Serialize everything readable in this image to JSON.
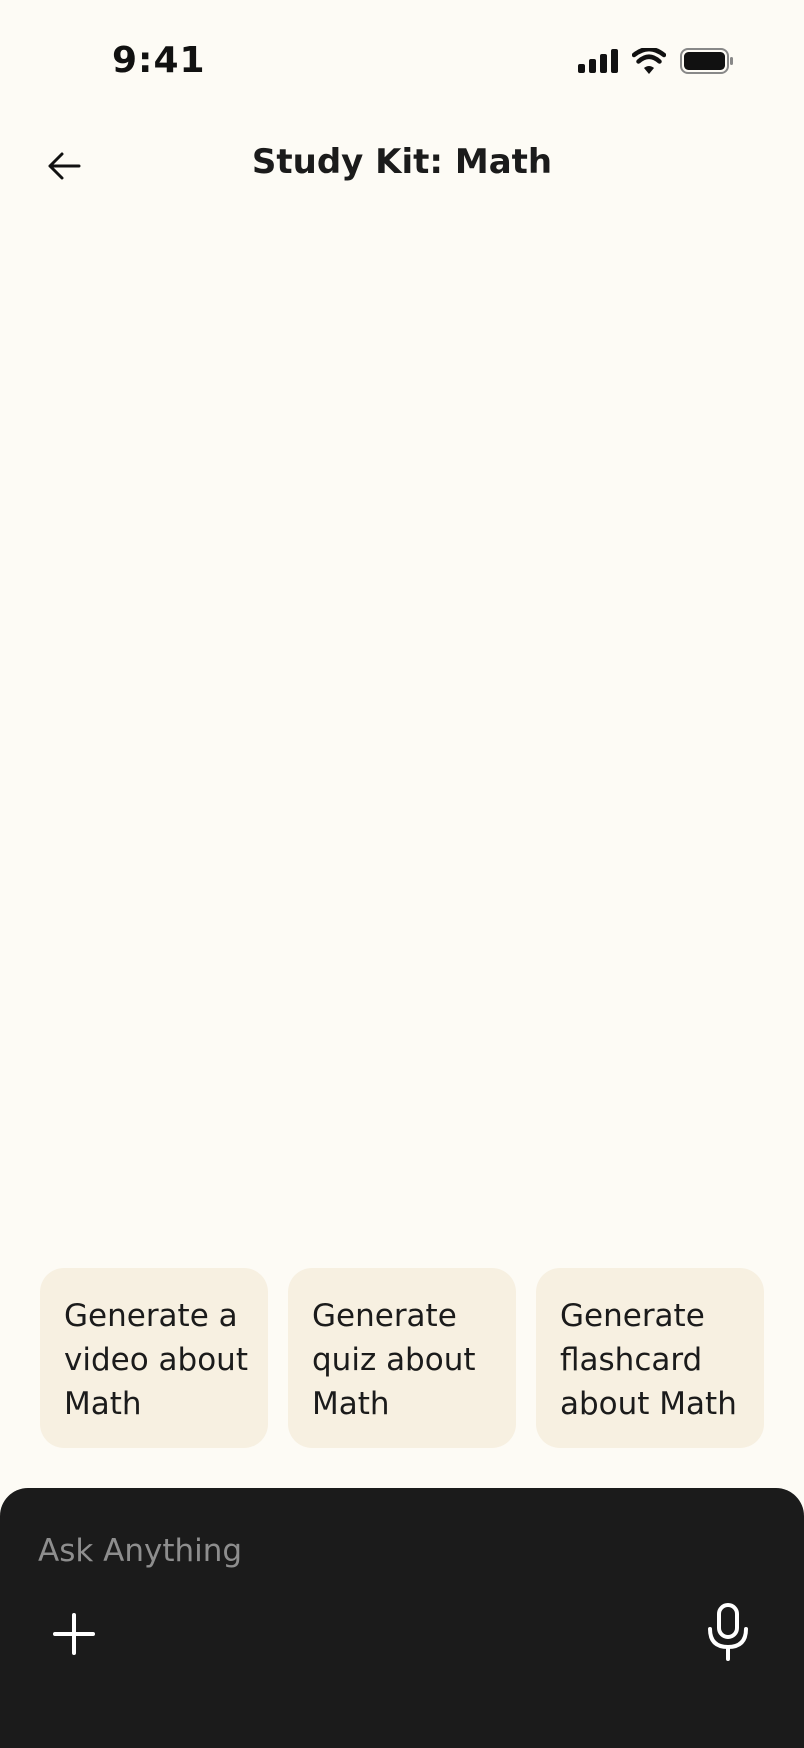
{
  "status_bar": {
    "time": "9:41",
    "icons": [
      "cellular-signal-icon",
      "wifi-icon",
      "battery-icon"
    ]
  },
  "nav": {
    "back_icon": "arrow-left-icon",
    "title": "Study Kit: Math"
  },
  "suggestions": [
    {
      "label": "Generate a video about Math"
    },
    {
      "label": "Generate quiz about Math"
    },
    {
      "label": "Generate flashcard about Math"
    }
  ],
  "composer": {
    "placeholder": "Ask Anything",
    "value": "",
    "add_icon": "plus-icon",
    "mic_icon": "microphone-icon"
  },
  "colors": {
    "background": "#FDFBF5",
    "card": "#F7F0E1",
    "composer": "#1B1B1B",
    "text": "#1B1B1B",
    "placeholder": "#8E8E8E"
  }
}
